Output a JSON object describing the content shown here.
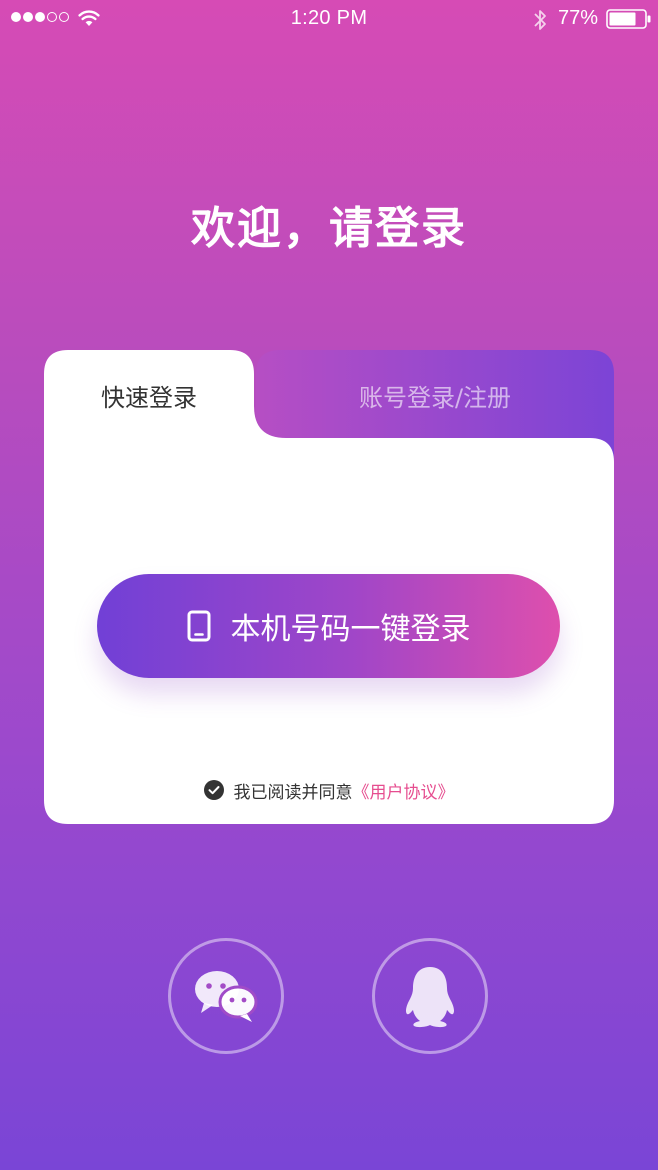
{
  "status_bar": {
    "time": "1:20 PM",
    "battery": "77%",
    "signal_icon": "signal-dots-icon",
    "wifi_icon": "wifi-icon",
    "bluetooth_icon": "bluetooth-icon",
    "battery_icon": "battery-icon"
  },
  "title": "欢迎，请登录",
  "tabs": [
    {
      "label": "快速登录",
      "active": true
    },
    {
      "label": "账号登录/注册",
      "active": false
    }
  ],
  "one_key_login": {
    "label": "本机号码一键登录",
    "icon": "phone-icon"
  },
  "agreement": {
    "prefix": "我已阅读并同意",
    "link": "《用户协议》",
    "checked": true
  },
  "social": [
    {
      "name": "wechat",
      "icon": "wechat-icon"
    },
    {
      "name": "qq",
      "icon": "qq-penguin-icon"
    }
  ],
  "colors": {
    "background_top": "#d64bb5",
    "background_bottom": "#7a45d6",
    "button_start": "#7140d6",
    "button_end": "#de4fad",
    "link": "#e64d8f",
    "tab_inactive": "#9a47d0"
  }
}
